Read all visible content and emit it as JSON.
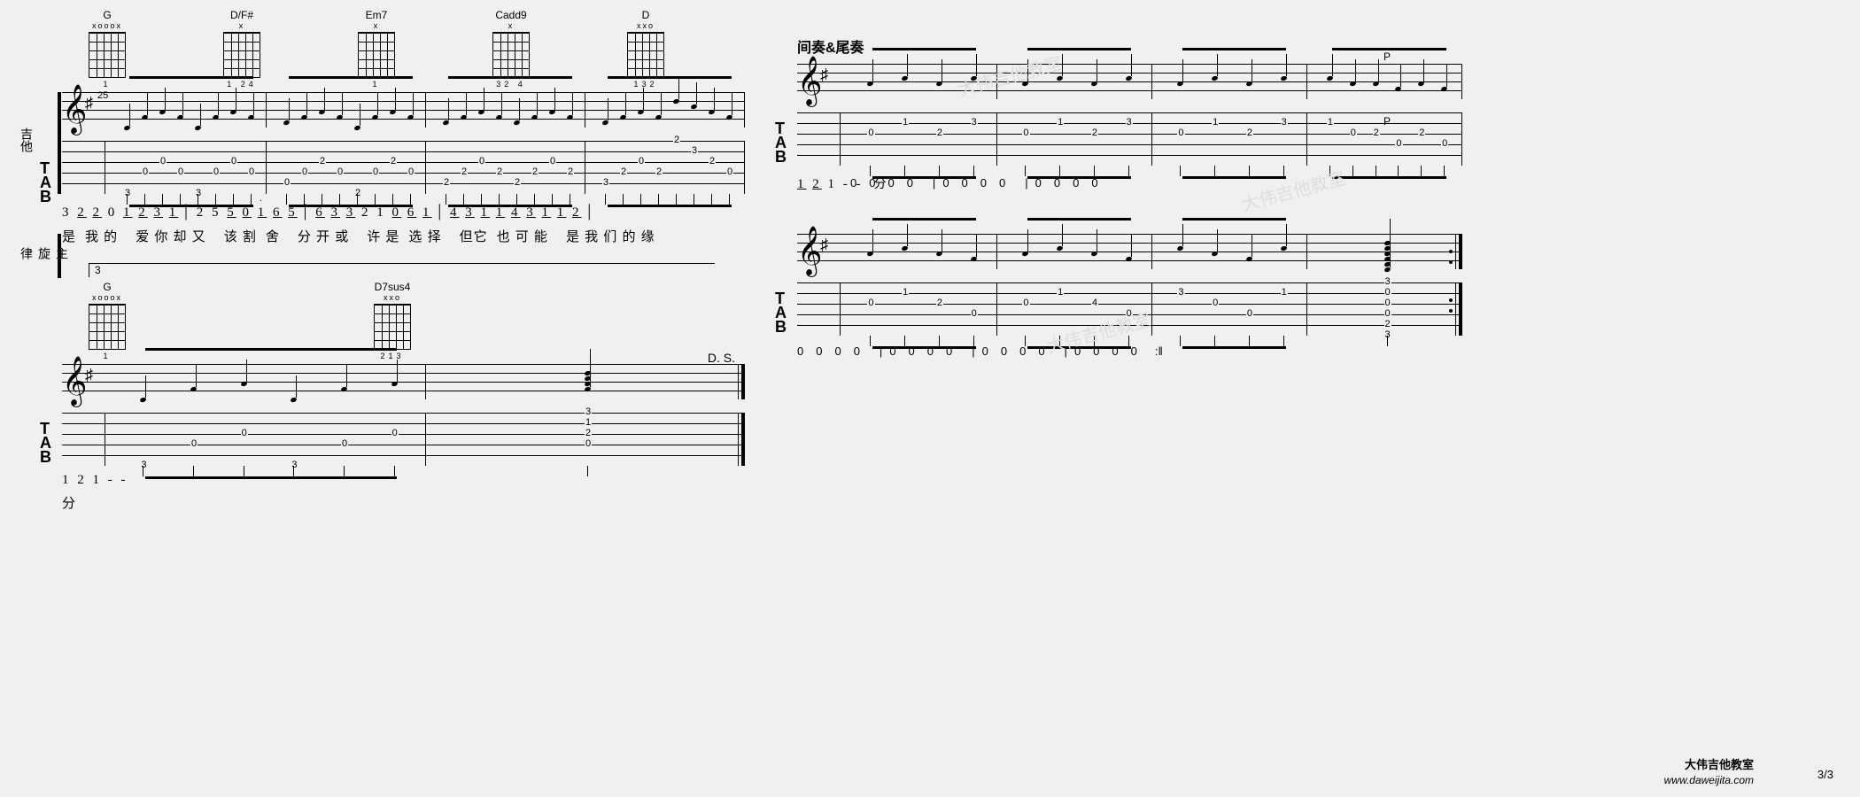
{
  "chords_row1": [
    {
      "name": "G",
      "head": "xooox",
      "fingers": "1"
    },
    {
      "name": "D/F#",
      "head": "x",
      "fingers": "1  24"
    },
    {
      "name": "Em7",
      "head": "x",
      "fingers": "1"
    },
    {
      "name": "Cadd9",
      "head": "x",
      "fingers": "32 4"
    },
    {
      "name": "D",
      "head": "xxo",
      "fingers": "132"
    }
  ],
  "chords_row2": [
    {
      "name": "G",
      "head": "xooox",
      "fingers": "1"
    },
    {
      "name": "D7sus4",
      "head": "xxo",
      "fingers": "213"
    }
  ],
  "labels": {
    "guitar": "吉他",
    "melody": "主旋律"
  },
  "measure_start": "25",
  "tab_system1": {
    "bars": [
      {
        "notes": [
          {
            "s": 6,
            "f": 3
          },
          {
            "s": 4,
            "f": 0
          },
          {
            "s": 3,
            "f": 0
          },
          {
            "s": 4,
            "f": 0
          },
          {
            "s": 6,
            "f": 3
          },
          {
            "s": 4,
            "f": 0
          },
          {
            "s": 3,
            "f": 0
          },
          {
            "s": 4,
            "f": 0
          }
        ]
      },
      {
        "notes": [
          {
            "s": 5,
            "f": 0
          },
          {
            "s": 4,
            "f": 0
          },
          {
            "s": 3,
            "f": 2
          },
          {
            "s": 4,
            "f": 0
          },
          {
            "s": 6,
            "f": 2
          },
          {
            "s": 4,
            "f": 0
          },
          {
            "s": 3,
            "f": 2
          },
          {
            "s": 4,
            "f": 0
          }
        ]
      },
      {
        "notes": [
          {
            "s": 5,
            "f": 2
          },
          {
            "s": 4,
            "f": 2
          },
          {
            "s": 3,
            "f": 0
          },
          {
            "s": 4,
            "f": 2
          },
          {
            "s": 5,
            "f": 2
          },
          {
            "s": 4,
            "f": 2
          },
          {
            "s": 3,
            "f": 0
          },
          {
            "s": 4,
            "f": 2
          }
        ]
      },
      {
        "notes": [
          {
            "s": 5,
            "f": 3
          },
          {
            "s": 4,
            "f": 2
          },
          {
            "s": 3,
            "f": 0
          },
          {
            "s": 4,
            "f": 2
          },
          {
            "s": 1,
            "f": 2
          },
          {
            "s": 2,
            "f": 3
          },
          {
            "s": 3,
            "f": 2
          },
          {
            "s": 4,
            "f": 0
          }
        ]
      }
    ]
  },
  "jianpu_line1": "3  2͟ 2͟ 0   1͟ 2͟ 3͟ 1͟  |  2  5   5͟ 0͟ 1̇͟ 6͟ 5͟  |  6͟.͟ 3͟ 3͟ 2  1  0͟ 6͟ 1͟  |  4͟ 3͟ 1͟ 1͟ 4͟ 3͟  1͟ 1͟ 2͟  |",
  "lyrics_line1": [
    "是",
    "我 的",
    "",
    "爱 你 却 又",
    "",
    "该 割",
    "舍",
    "",
    "分 开 或",
    "",
    "许 是",
    "选 择",
    "",
    "但它",
    "也 可 能",
    "",
    "是 我 们 的 缘"
  ],
  "jianpu_line2": "1      2           1             -              -",
  "lyrics_line2": "分",
  "volta_num": "3",
  "ds_label": "D. S.",
  "tab_system2": {
    "bars": [
      {
        "notes": [
          {
            "s": 6,
            "f": 3
          },
          {
            "s": 4,
            "f": 0
          },
          {
            "s": 3,
            "f": 0
          },
          {
            "s": 6,
            "f": 3
          },
          {
            "s": 4,
            "f": 0
          },
          {
            "s": 3,
            "f": 0
          }
        ]
      },
      {
        "chord": [
          {
            "s": 1,
            "f": 3
          },
          {
            "s": 2,
            "f": 1
          },
          {
            "s": 3,
            "f": 2
          },
          {
            "s": 4,
            "f": 0
          }
        ]
      }
    ]
  },
  "section_label_r": "间奏&尾奏",
  "p_marks": [
    "P",
    "P"
  ],
  "tab_system3": {
    "bars": [
      {
        "notes": [
          {
            "s": 3,
            "f": 0
          },
          {
            "s": 2,
            "f": 1
          },
          {
            "s": 3,
            "f": 2
          },
          {
            "s": 2,
            "f": 3
          }
        ]
      },
      {
        "notes": [
          {
            "s": 3,
            "f": 0
          },
          {
            "s": 2,
            "f": 1
          },
          {
            "s": 3,
            "f": 2
          },
          {
            "s": 2,
            "f": 3
          }
        ]
      },
      {
        "notes": [
          {
            "s": 3,
            "f": 0
          },
          {
            "s": 2,
            "f": 1
          },
          {
            "s": 3,
            "f": 2
          },
          {
            "s": 2,
            "f": 3
          }
        ]
      },
      {
        "notes": [
          {
            "s": 2,
            "f": 1
          },
          {
            "s": 3,
            "f": 0
          },
          {
            "s": 3,
            "f": 2
          },
          {
            "s": 4,
            "f": 0
          },
          {
            "s": 3,
            "f": 2
          },
          {
            "s": 4,
            "f": 0
          }
        ]
      }
    ]
  },
  "jianpu_line3": "1͟ 2͟  1   -    -",
  "lyrics_line3": "分",
  "rhythm_r1": [
    "0",
    "0",
    "0",
    "0",
    "|",
    "0",
    "0",
    "0",
    "0",
    "|",
    "0",
    "0",
    "0",
    "0"
  ],
  "tab_system4": {
    "bars": [
      {
        "notes": [
          {
            "s": 3,
            "f": 0
          },
          {
            "s": 2,
            "f": 1
          },
          {
            "s": 3,
            "f": 2
          },
          {
            "s": 4,
            "f": 0
          }
        ]
      },
      {
        "notes": [
          {
            "s": 3,
            "f": 0
          },
          {
            "s": 2,
            "f": 1
          },
          {
            "s": 3,
            "f": 4
          },
          {
            "s": 4,
            "f": 0
          }
        ]
      },
      {
        "notes": [
          {
            "s": 2,
            "f": 3
          },
          {
            "s": 3,
            "f": 0
          },
          {
            "s": 4,
            "f": 0
          },
          {
            "s": 2,
            "f": 1
          }
        ]
      },
      {
        "chord": [
          {
            "s": 1,
            "f": 3
          },
          {
            "s": 2,
            "f": 0
          },
          {
            "s": 3,
            "f": 0
          },
          {
            "s": 4,
            "f": 0
          },
          {
            "s": 5,
            "f": 2
          },
          {
            "s": 6,
            "f": 3
          }
        ]
      }
    ]
  },
  "rhythm_r2": [
    "0",
    "0",
    "0",
    "0",
    "|",
    "0",
    "0",
    "0",
    "0",
    "|",
    "0",
    "0",
    "0",
    "0",
    "|",
    "0",
    "0",
    "0",
    "0",
    ":||"
  ],
  "watermarks": [
    "大伟吉他教室",
    "大伟吉他教室",
    "大伟吉他教室"
  ],
  "footer": {
    "brand": "大伟吉他教室",
    "url": "www.daweijita.com",
    "page": "3/3"
  }
}
